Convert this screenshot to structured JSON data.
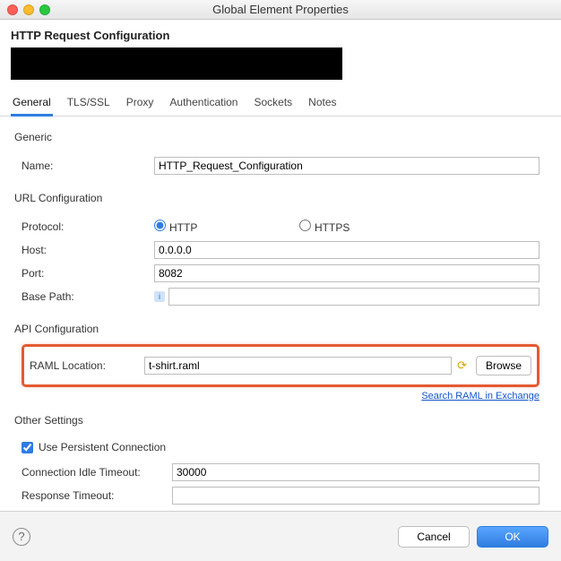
{
  "window": {
    "title": "Global Element Properties"
  },
  "header": {
    "title": "HTTP Request Configuration"
  },
  "tabs": [
    "General",
    "TLS/SSL",
    "Proxy",
    "Authentication",
    "Sockets",
    "Notes"
  ],
  "active_tab_index": 0,
  "sections": {
    "generic": {
      "title": "Generic",
      "name_label": "Name:",
      "name_value": "HTTP_Request_Configuration"
    },
    "url": {
      "title": "URL Configuration",
      "protocol_label": "Protocol:",
      "protocol_options": [
        "HTTP",
        "HTTPS"
      ],
      "protocol_selected": "HTTP",
      "host_label": "Host:",
      "host_value": "0.0.0.0",
      "port_label": "Port:",
      "port_value": "8082",
      "basepath_label": "Base Path:",
      "basepath_value": ""
    },
    "api": {
      "title": "API Configuration",
      "raml_label": "RAML Location:",
      "raml_value": "t-shirt.raml",
      "browse_label": "Browse",
      "search_link": "Search RAML in Exchange"
    },
    "other": {
      "title": "Other Settings",
      "use_persistent_label": "Use Persistent Connection",
      "use_persistent_checked": true,
      "conn_idle_label": "Connection Idle Timeout:",
      "conn_idle_value": "30000",
      "resp_timeout_label": "Response Timeout:",
      "resp_timeout_value": ""
    }
  },
  "footer": {
    "cancel": "Cancel",
    "ok": "OK"
  }
}
